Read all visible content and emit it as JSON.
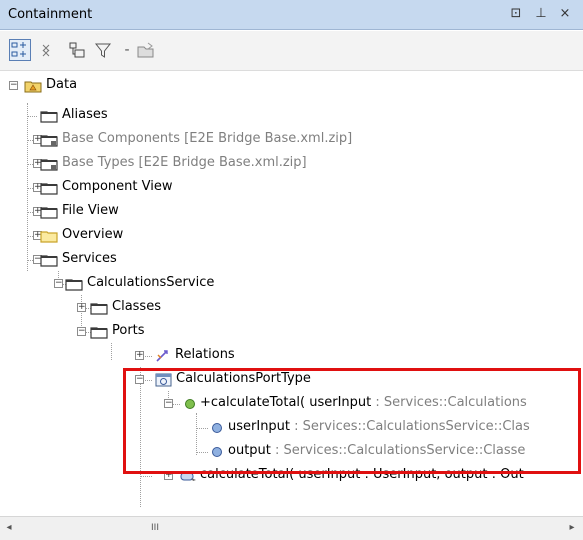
{
  "window": {
    "title": "Containment",
    "buttons": [
      "restore-icon",
      "pin-icon",
      "close-icon"
    ],
    "restore_glyph": "⊡",
    "pin_glyph": "⊥",
    "close_glyph": "×"
  },
  "toolbar": {
    "icons": [
      "expand-all-icon",
      "collapse-all-icon",
      "show-in-browser-icon",
      "filter-icon",
      "filter-dropdown-icon",
      "new-package-icon"
    ],
    "filter_dropdown_glyph": "-"
  },
  "tree": {
    "root": "Data",
    "level1": [
      {
        "label": "Aliases"
      },
      {
        "label": "Base Components [E2E Bridge Base.xml.zip]"
      },
      {
        "label": "Base Types [E2E Bridge Base.xml.zip]"
      },
      {
        "label": "Component View"
      },
      {
        "label": "File View"
      },
      {
        "label": "Overview"
      },
      {
        "label": "Services"
      }
    ],
    "calc_service": "CalculationsService",
    "classes": "Classes",
    "ports": "Ports",
    "relations": "Relations",
    "port_type": "CalculationsPortType",
    "operation": {
      "name": "+calculateTotal( userInput",
      "rest": " : Services::Calculations"
    },
    "param_user": {
      "name": "userInput",
      "rest": " : Services::CalculationsService::Clas"
    },
    "param_output": {
      "name": "output",
      "rest": " : Services::CalculationsService::Classe"
    },
    "call_action": "calculateTotal( userInput : UserInput, output : Out"
  },
  "colors": {
    "title_bar": "#c6d9ef",
    "highlight_border": "#e01010",
    "grey_text": "#7f7f7f",
    "folder": "#3a3a3a",
    "overview_folder": "#f2d36a",
    "data_folder": "#f2d36a"
  },
  "scrollbar": {
    "left_arrow": "◂",
    "right_arrow": "▸",
    "thumb_grip": "III"
  }
}
